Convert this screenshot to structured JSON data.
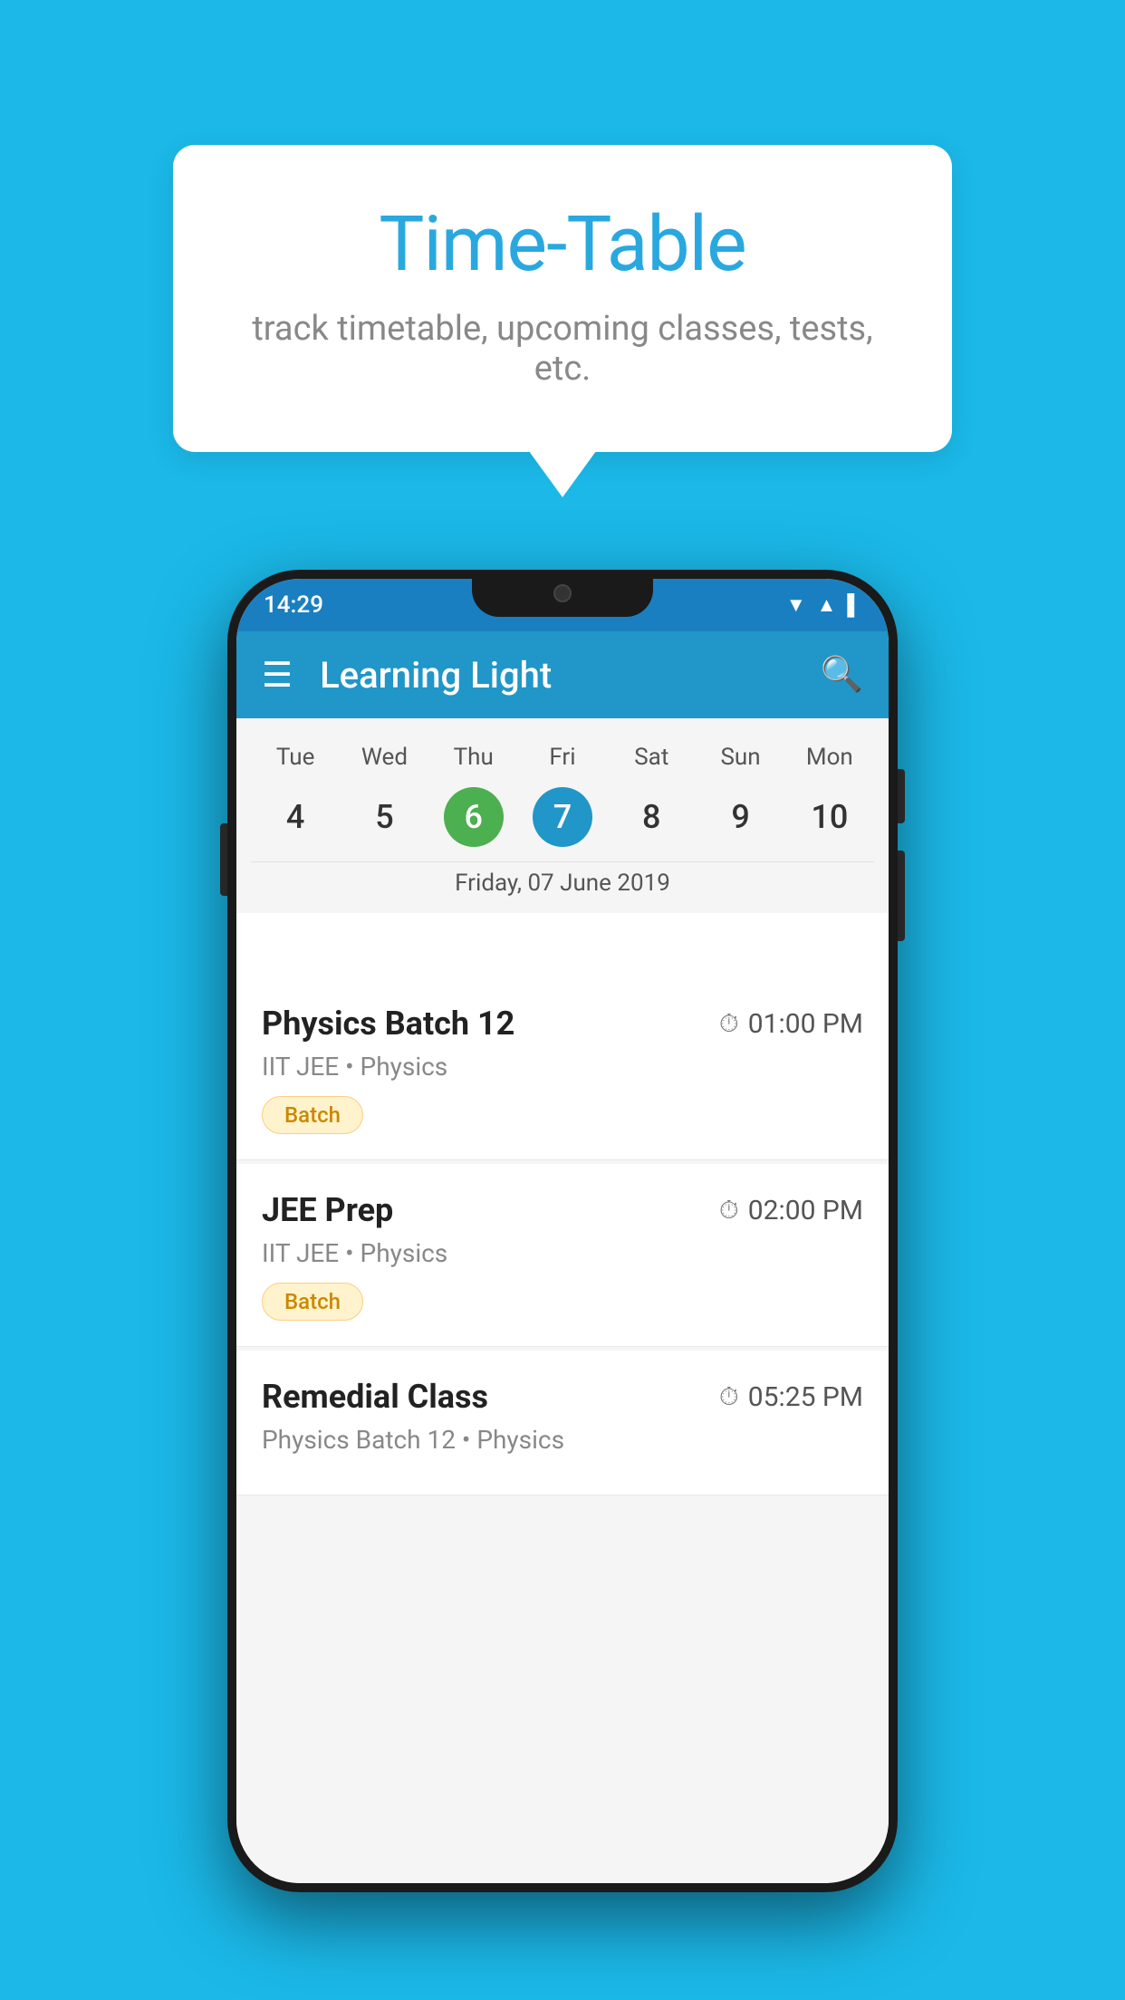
{
  "background_color": "#1BB8E8",
  "tooltip": {
    "title": "Time-Table",
    "subtitle": "track timetable, upcoming classes, tests, etc."
  },
  "phone": {
    "status_bar": {
      "time": "14:29"
    },
    "app_bar": {
      "title": "Learning Light"
    },
    "calendar": {
      "days": [
        "Tue",
        "Wed",
        "Thu",
        "Fri",
        "Sat",
        "Sun",
        "Mon"
      ],
      "dates": [
        "4",
        "5",
        "6",
        "7",
        "8",
        "9",
        "10"
      ],
      "today_index": 2,
      "selected_index": 3,
      "selected_date_label": "Friday, 07 June 2019"
    },
    "schedule": [
      {
        "title": "Physics Batch 12",
        "time": "01:00 PM",
        "sub": "IIT JEE • Physics",
        "tag": "Batch"
      },
      {
        "title": "JEE Prep",
        "time": "02:00 PM",
        "sub": "IIT JEE • Physics",
        "tag": "Batch"
      },
      {
        "title": "Remedial Class",
        "time": "05:25 PM",
        "sub": "Physics Batch 12 • Physics",
        "tag": null
      }
    ]
  }
}
